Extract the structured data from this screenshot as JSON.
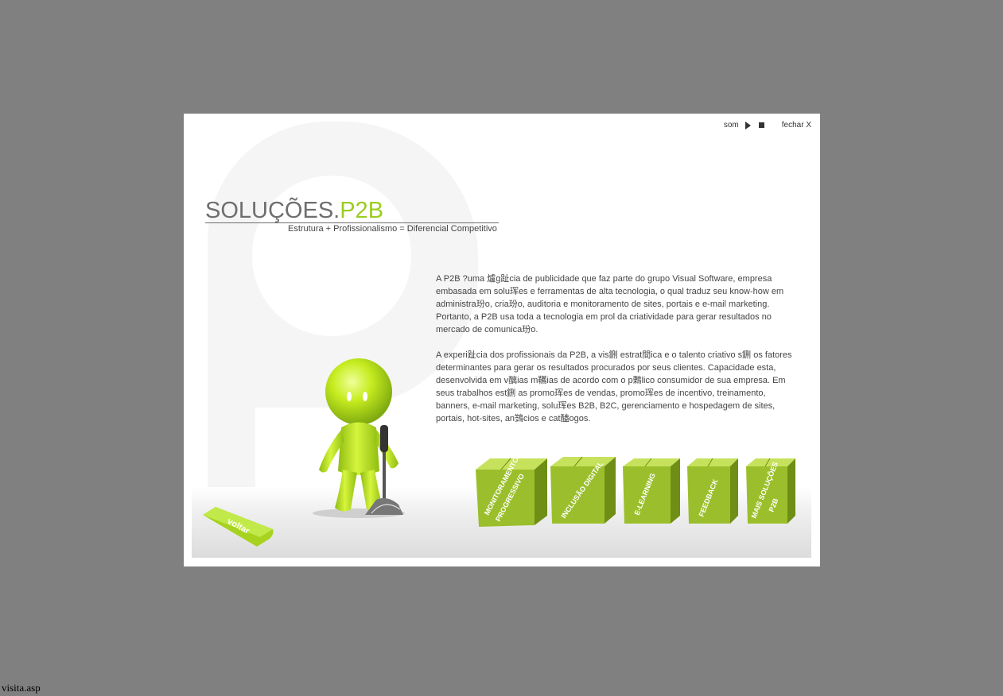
{
  "header": {
    "sound_label": "som",
    "close_label": "fechar X"
  },
  "brand": {
    "title_main": "SOLUÇÕES.",
    "title_accent": "P2B",
    "tagline": "Estrutura + Profissionalismo = Diferencial Competitivo"
  },
  "content": {
    "paragraph1": "A P2B ?uma 爐g趾cia de publicidade que faz parte do grupo Visual Software, empresa embasada em solu珲es e ferramentas de alta tecnologia, o qual traduz seu know-how em administra玢o, cria玢o, auditoria e monitoramento de sites, portais e e-mail marketing. Portanto, a P2B usa toda a tecnologia em prol da criatividade para gerar resultados no mercado de comunica玢o.",
    "paragraph2": "A experi趾cia dos profissionais da P2B, a vis鉶 estrat間ica e o talento criativo s鉶 os fatores determinantes para gerar os resultados procurados por seus clientes. Capacidade esta, desenvolvida em v醨ias m韉ias de acordo com o p鷅lico consumidor de sua empresa. Em seus trabalhos est鉶 as promo珲es de vendas, promo珲es de incentivo, treinamento, banners, e-mail marketing, solu珲es B2B, B2C, gerenciamento e hospedagem de sites, portais, hot-sites, an鷑cios e cat醠ogos."
  },
  "nav": {
    "back_label": "voltar",
    "boxes": [
      {
        "line1": "MONITORAMENTO",
        "line2": "PROGRESSIVO"
      },
      {
        "line1": "INCLUSÃO DIGITAL",
        "line2": ""
      },
      {
        "line1": "E-LEARNING",
        "line2": ""
      },
      {
        "line1": "FEEDBACK",
        "line2": ""
      },
      {
        "line1": "MAIS SOLUÇÕES",
        "line2": "P2B"
      }
    ]
  },
  "statusbar": {
    "text": "visita.asp"
  },
  "colors": {
    "background": "#808080",
    "panel": "#ffffff",
    "accent": "#9acd1e",
    "box_green": "#9bbf2c"
  }
}
